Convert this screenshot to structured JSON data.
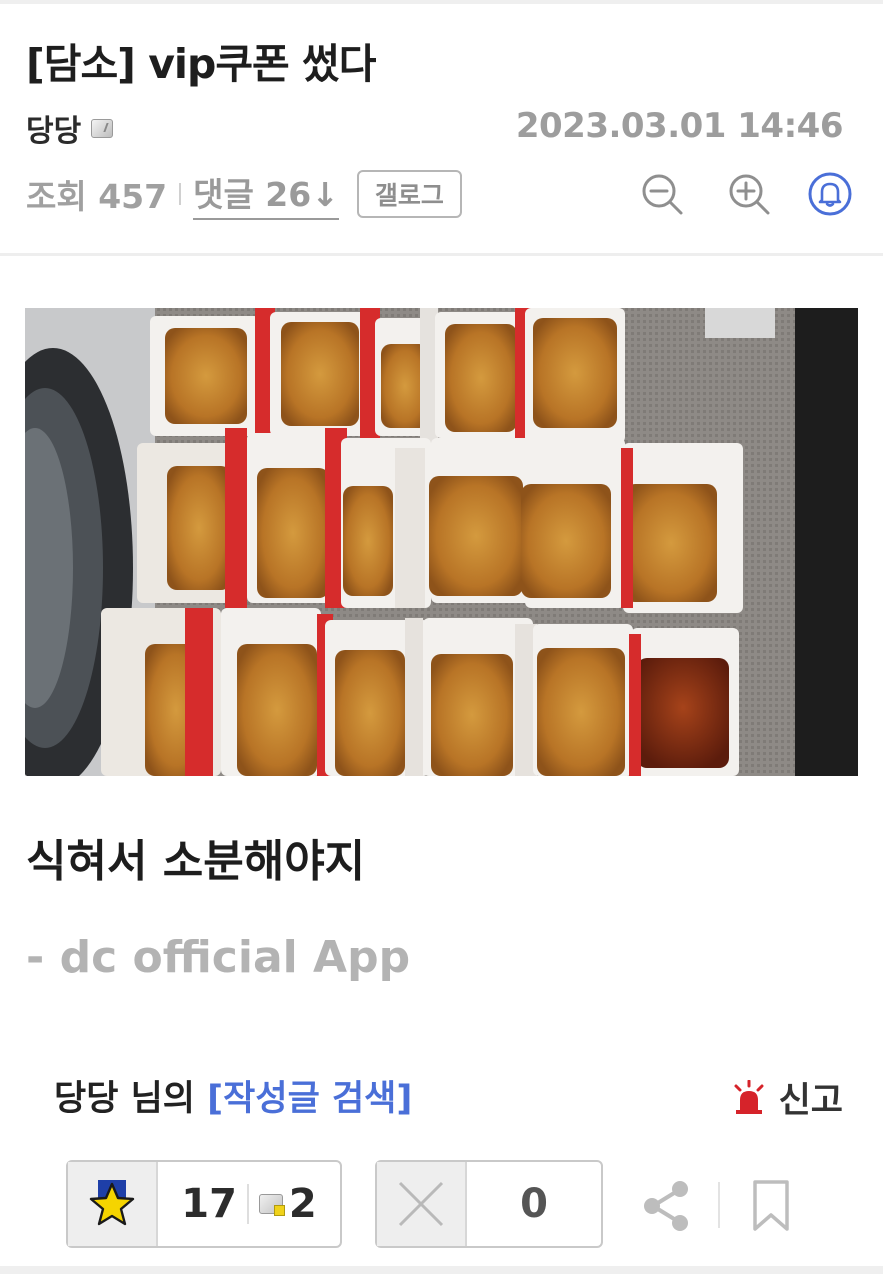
{
  "post": {
    "title": "[담소] vip쿠폰 썼다",
    "author": "당당",
    "datetime": "2023.03.01 14:46",
    "views_label": "조회 457",
    "comments_label": "댓글 26↓",
    "gallog_button": "갤로그",
    "body_text": "식혀서 소분해야지",
    "signature": "- dc official App"
  },
  "photo": {
    "icon": "photo-of-fried-chicken-boxes"
  },
  "footer": {
    "writer_posts_prefix": "당당 님의 ",
    "writer_posts_link": "[작성글 검색]",
    "report_label": "신고"
  },
  "recommend": {
    "count": "17",
    "fixed_count": "2",
    "nonrecommend_count": "0"
  },
  "colors": {
    "accent_blue": "#4a6fd8",
    "report_red": "#d6232a",
    "star_yellow": "#f5d400",
    "star_blue": "#1e3fa8"
  },
  "icons": [
    "gallog-icon",
    "zoom-out-icon",
    "zoom-in-icon",
    "bell-icon",
    "siren-icon",
    "star-icon",
    "fixed-member-icon",
    "x-icon",
    "share-icon",
    "bookmark-icon"
  ]
}
